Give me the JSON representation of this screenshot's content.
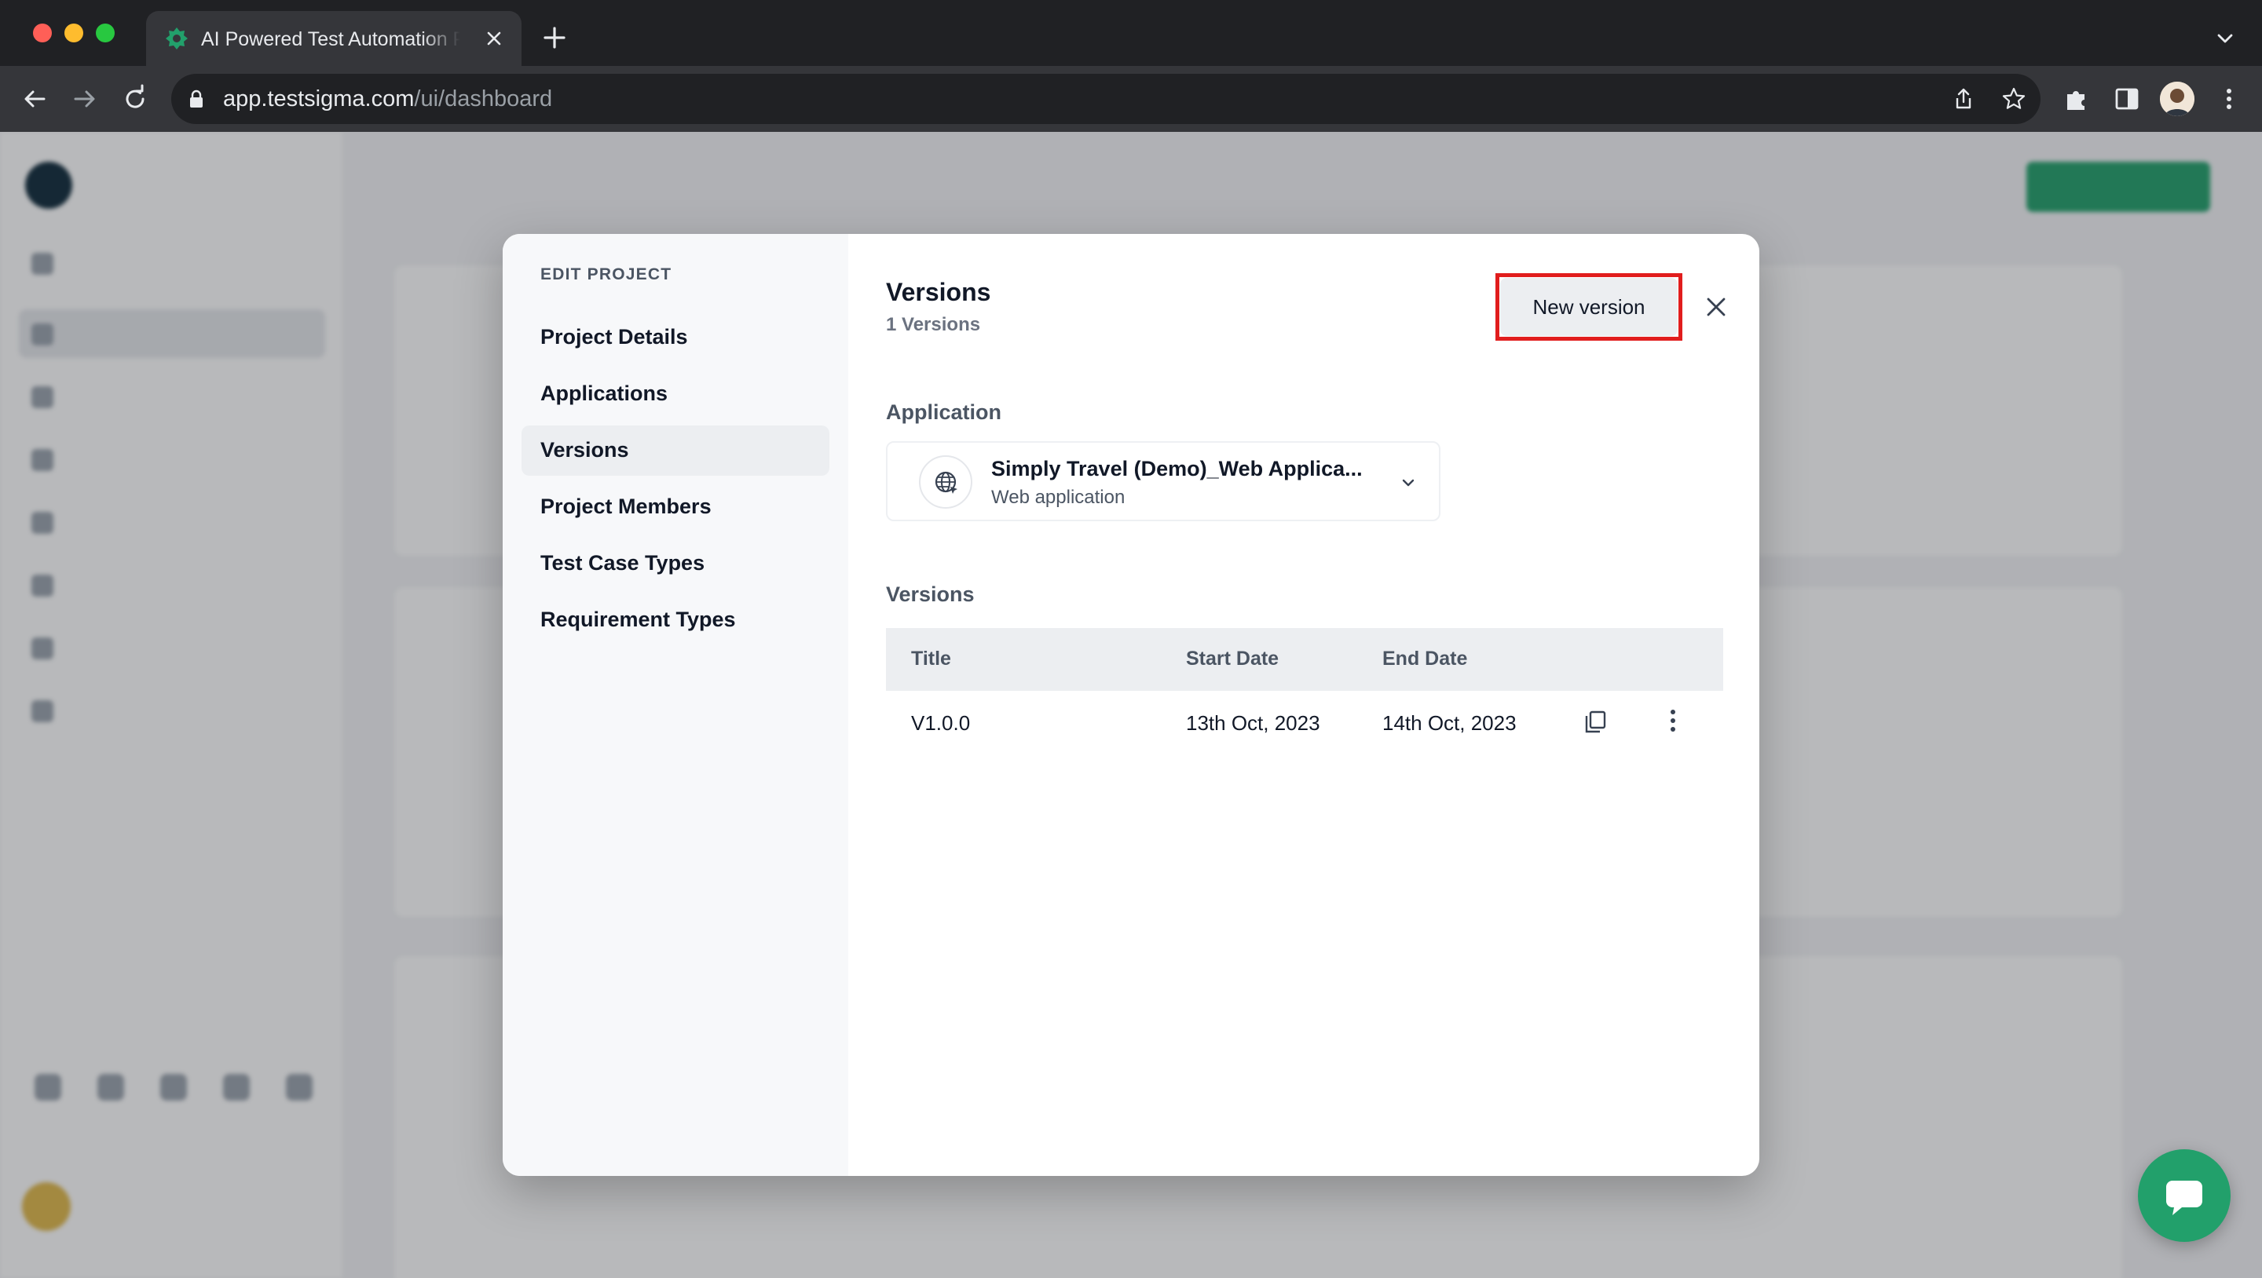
{
  "browser": {
    "tab_title": "AI Powered Test Automation Platform",
    "url_host": "app.testsigma.com",
    "url_path": "/ui/dashboard"
  },
  "modal": {
    "nav_heading": "EDIT PROJECT",
    "nav_items": [
      {
        "label": "Project Details"
      },
      {
        "label": "Applications"
      },
      {
        "label": "Versions"
      },
      {
        "label": "Project Members"
      },
      {
        "label": "Test Case Types"
      },
      {
        "label": "Requirement Types"
      }
    ],
    "active_nav": "Versions",
    "title": "Versions",
    "count": "1 Versions",
    "new_version_label": "New version",
    "application_label": "Application",
    "application": {
      "name": "Simply Travel (Demo)_Web Applica...",
      "type": "Web application"
    },
    "versions_label": "Versions",
    "table": {
      "columns": [
        "Title",
        "Start Date",
        "End Date"
      ],
      "rows": [
        {
          "title": "V1.0.0",
          "start": "13th Oct, 2023",
          "end": "14th Oct, 2023"
        }
      ]
    }
  },
  "colors": {
    "brand_green": "#22a06b",
    "highlight_red": "#e11d1d"
  }
}
